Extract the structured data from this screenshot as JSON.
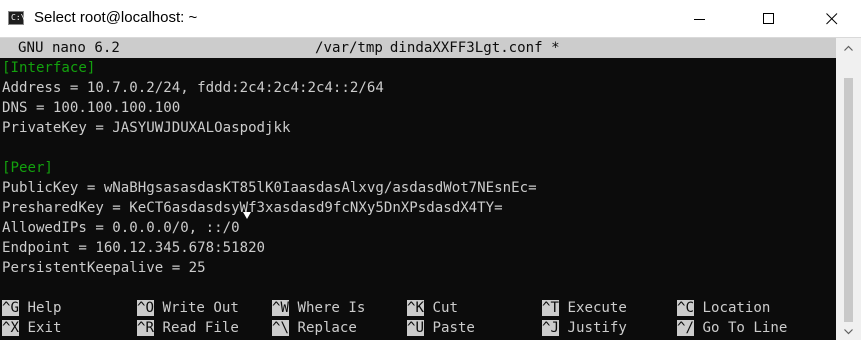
{
  "window": {
    "title": "Select root@localhost: ~",
    "icon": "console-icon",
    "icon_glyph": "C:\\"
  },
  "nano": {
    "version": "GNU nano 6.2",
    "path_dir": "/var/tmp",
    "path_sep": "/",
    "path_file": "dindaXXFF3Lgt.conf",
    "modified": "*"
  },
  "file_lines": [
    {
      "kind": "section",
      "text": "[Interface]"
    },
    {
      "kind": "plain",
      "text": "Address = 10.7.0.2/24, fddd:2c4:2c4:2c4::2/64"
    },
    {
      "kind": "plain",
      "text": "DNS = 100.100.100.100"
    },
    {
      "kind": "plain",
      "text": "PrivateKey = JASYUWJDUXALOaspodjkk"
    },
    {
      "kind": "plain",
      "text": ""
    },
    {
      "kind": "section",
      "text": "[Peer]"
    },
    {
      "kind": "plain",
      "text": "PublicKey = wNaBHgsasasdasKT85lK0IaasdasAlxvg/asdasdWot7NEsnEc="
    },
    {
      "kind": "plain",
      "text": "PresharedKey = KeCT6asdasdsyWf3xasdasd9fcNXy5DnXPsdasdX4TY="
    },
    {
      "kind": "plain",
      "text": "AllowedIPs = 0.0.0.0/0, ::/0"
    },
    {
      "kind": "plain",
      "text": "Endpoint = 160.12.345.678:51820"
    },
    {
      "kind": "plain",
      "text": "PersistentKeepalive = 25"
    }
  ],
  "shortcuts": {
    "row1": [
      {
        "key": "^G",
        "label": "Help"
      },
      {
        "key": "^O",
        "label": "Write Out"
      },
      {
        "key": "^W",
        "label": "Where Is"
      },
      {
        "key": "^K",
        "label": "Cut"
      },
      {
        "key": "^T",
        "label": "Execute"
      },
      {
        "key": "^C",
        "label": "Location"
      }
    ],
    "row2": [
      {
        "key": "^X",
        "label": "Exit"
      },
      {
        "key": "^R",
        "label": "Read File"
      },
      {
        "key": "^\\",
        "label": "Replace"
      },
      {
        "key": "^U",
        "label": "Paste"
      },
      {
        "key": "^J",
        "label": "Justify"
      },
      {
        "key": "^/",
        "label": "Go To Line"
      }
    ]
  },
  "colors": {
    "terminal_bg": "#0c0c0c",
    "terminal_fg": "#cccccc",
    "section_green": "#13a10e"
  }
}
